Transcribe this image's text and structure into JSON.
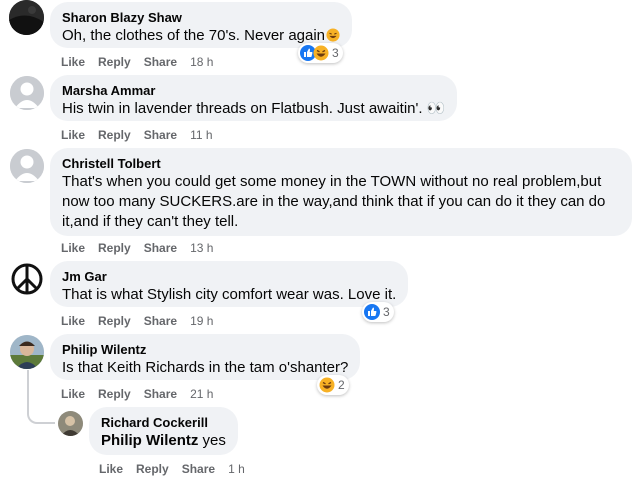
{
  "actions": {
    "like": "Like",
    "reply": "Reply",
    "share": "Share"
  },
  "comments": [
    {
      "author": "Sharon Blazy Shaw",
      "text": "Oh, the clothes of the 70's. Never again",
      "time": "18 h",
      "reaction_count": "3",
      "reactions": [
        "like-icon",
        "laugh-icon"
      ]
    },
    {
      "author": "Marsha Ammar",
      "text": "His twin in lavender threads on Flatbush. Just awaitin'. 👀",
      "time": "11 h"
    },
    {
      "author": "Christell Tolbert",
      "text_lines": [
        "That's when you could get some money in the TOWN without no real problem,but",
        "now too many SUCKERS.are in the way,and think that if you can do it they can do",
        "it,and if they can't they tell."
      ],
      "time": "13 h"
    },
    {
      "author": "Jm Gar",
      "text": "That is what Stylish city comfort wear was. Love it.",
      "time": "19 h",
      "reaction_count": "3",
      "reactions": [
        "like-icon"
      ]
    },
    {
      "author": "Philip Wilentz",
      "text": "Is that Keith Richards in the tam o'shanter?",
      "time": "21 h",
      "reaction_count": "2",
      "reactions": [
        "laugh-icon"
      ]
    },
    {
      "author": "Richard Cockerill",
      "mention": "Philip Wilentz",
      "text": " yes",
      "time": "1 h"
    }
  ]
}
